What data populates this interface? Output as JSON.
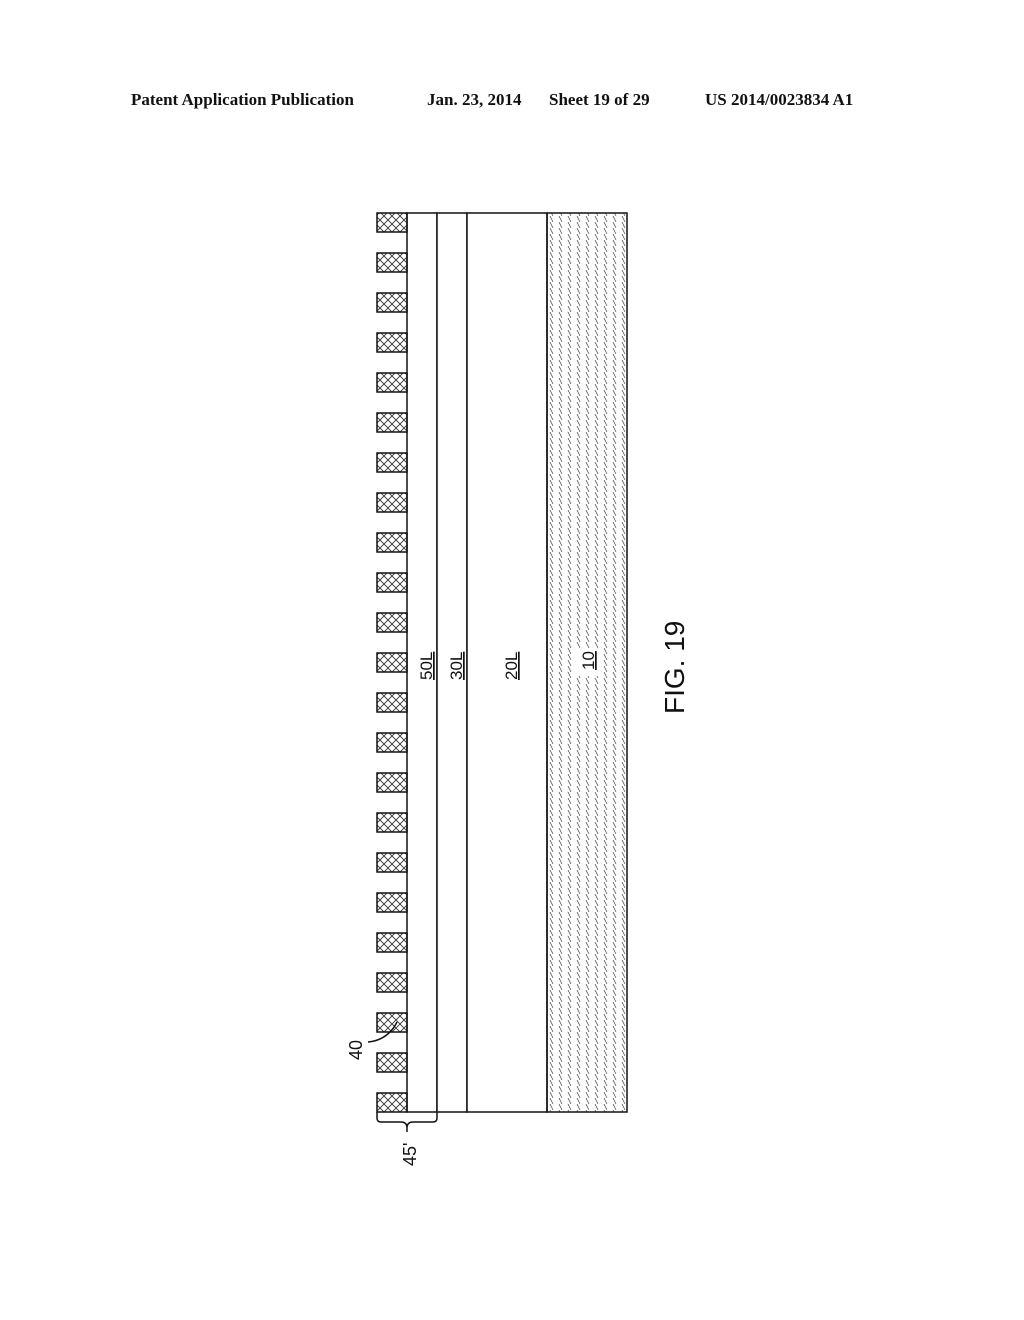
{
  "header": {
    "publication": "Patent Application Publication",
    "date": "Jan. 23, 2014",
    "sheet": "Sheet 19 of 29",
    "number": "US 2014/0023834 A1"
  },
  "figure": {
    "caption": "FIG. 19",
    "pad_count": 23,
    "layers": [
      {
        "id": "50L",
        "label": "50L",
        "fill": "none"
      },
      {
        "id": "30L",
        "label": "30L",
        "fill": "none"
      },
      {
        "id": "20L",
        "label": "20L",
        "fill": "none"
      },
      {
        "id": "10",
        "label": "10",
        "fill": "diagonal-hatch"
      }
    ],
    "pad_label": "40",
    "bracket_label": "45'",
    "pad_fill": "cross-hatch"
  }
}
